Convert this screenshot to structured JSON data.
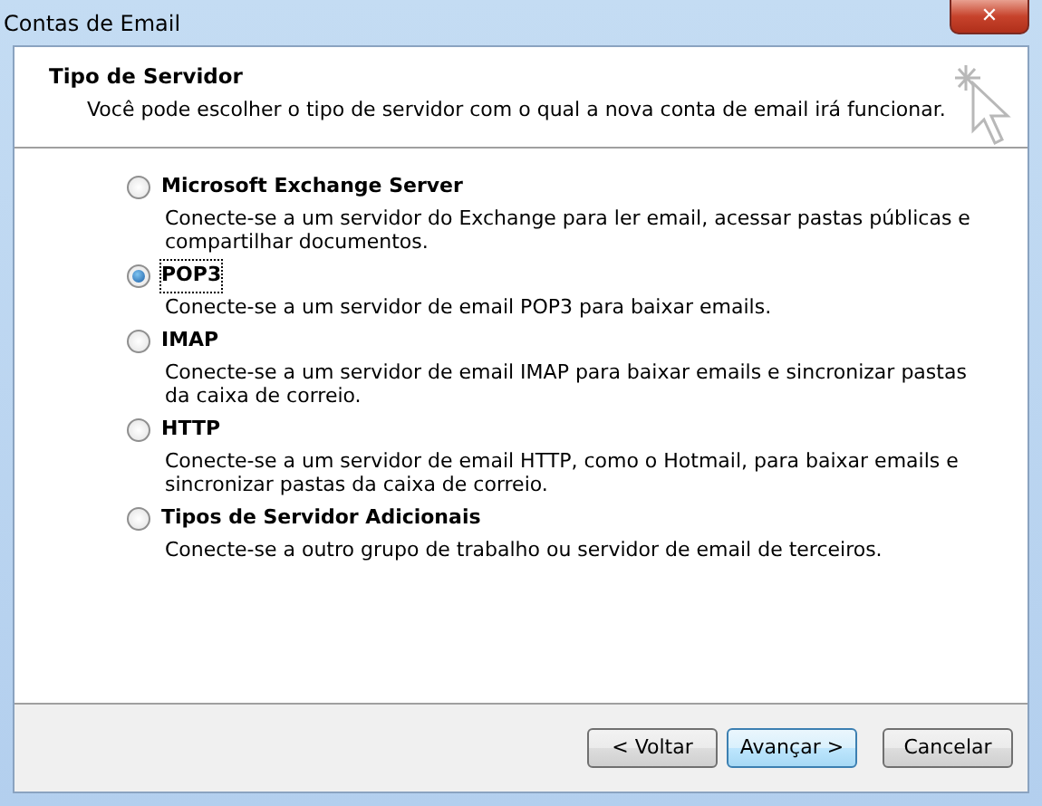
{
  "window": {
    "title": "Contas de Email",
    "close": "✕"
  },
  "header": {
    "title": "Tipo de Servidor",
    "subtitle": "Você pode escolher o tipo de servidor com o qual a nova conta de email irá funcionar."
  },
  "options": [
    {
      "label": "Microsoft Exchange Server",
      "description": "Conecte-se a um servidor do Exchange para ler email, acessar pastas públicas e compartilhar documentos.",
      "selected": false
    },
    {
      "label": "POP3",
      "description": "Conecte-se a um servidor de email POP3 para baixar emails.",
      "selected": true
    },
    {
      "label": "IMAP",
      "description": "Conecte-se a um servidor de email IMAP para baixar emails e sincronizar pastas da caixa de correio.",
      "selected": false
    },
    {
      "label": "HTTP",
      "description": "Conecte-se a um servidor de email HTTP, como o Hotmail, para baixar emails e sincronizar pastas da caixa de correio.",
      "selected": false
    },
    {
      "label": "Tipos de Servidor Adicionais",
      "description": "Conecte-se a outro grupo de trabalho ou servidor de email de terceiros.",
      "selected": false
    }
  ],
  "buttons": [
    {
      "label": "< Voltar",
      "default": false
    },
    {
      "label": "Avançar >",
      "default": true
    },
    {
      "label": "Cancelar",
      "default": false
    }
  ]
}
